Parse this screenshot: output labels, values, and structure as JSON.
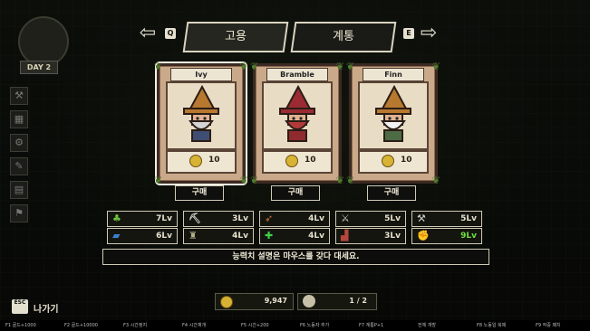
{
  "hud": {
    "day_label": "DAY 2"
  },
  "tabs": {
    "left_key": "Q",
    "right_key": "E",
    "items": [
      {
        "label": "고용",
        "active": true
      },
      {
        "label": "계통",
        "active": false
      }
    ]
  },
  "heroes": [
    {
      "name": "Ivy",
      "price": "10",
      "buy_label": "구매",
      "selected": true,
      "hat": "#b7782f",
      "robe": "#3f4d73",
      "beard": "#d4d4d4"
    },
    {
      "name": "Bramble",
      "price": "10",
      "buy_label": "구매",
      "selected": false,
      "hat": "#9a2b33",
      "robe": "#8f2a2e",
      "beard": "#b33a3a"
    },
    {
      "name": "Finn",
      "price": "10",
      "buy_label": "구매",
      "selected": false,
      "hat": "#b7782f",
      "robe": "#4d6b45",
      "beard": "#f2f2f2"
    }
  ],
  "stats": [
    {
      "icon": "sprout-icon",
      "glyph": "♣",
      "color": "#6fbf3f",
      "level": "7Lv",
      "highlight": false
    },
    {
      "icon": "pickaxe-icon",
      "glyph": "⛏",
      "color": "#cfcfcf",
      "level": "3Lv",
      "highlight": false
    },
    {
      "icon": "bow-icon",
      "glyph": "➶",
      "color": "#c7703a",
      "level": "4Lv",
      "highlight": false
    },
    {
      "icon": "sword-icon",
      "glyph": "⚔",
      "color": "#cfcfcf",
      "level": "5Lv",
      "highlight": false
    },
    {
      "icon": "axe-icon",
      "glyph": "⚒",
      "color": "#cfcfcf",
      "level": "5Lv",
      "highlight": false
    },
    {
      "icon": "book-icon",
      "glyph": "▰",
      "color": "#3f7fd1",
      "level": "6Lv",
      "highlight": false
    },
    {
      "icon": "bag-icon",
      "glyph": "♜",
      "color": "#b0b08a",
      "level": "4Lv",
      "highlight": false
    },
    {
      "icon": "heal-cross-icon",
      "glyph": "✚",
      "color": "#3fd14a",
      "level": "4Lv",
      "highlight": false
    },
    {
      "icon": "boot-icon",
      "glyph": "▟",
      "color": "#b3473d",
      "level": "3Lv",
      "highlight": false
    },
    {
      "icon": "strength-arm-icon",
      "glyph": "✊",
      "color": "#d9c9b8",
      "level": "9Lv",
      "highlight": true
    }
  ],
  "description": "능력치 설명은 마우스를 갖다 대세요.",
  "resources": {
    "gold": "9,947",
    "party": "1 / 2"
  },
  "exit": {
    "key": "ESC",
    "label": "나가기"
  },
  "cheats": [
    "F1 골드+1000",
    "F2 골드+10000",
    "F3 시간정지",
    "F4 시간재개",
    "F5 시간+200",
    "F6 노동자 추가",
    "F7 계통P+1",
    "전체 개방",
    "F8 노동일 복제",
    "F9 작중 패치"
  ]
}
